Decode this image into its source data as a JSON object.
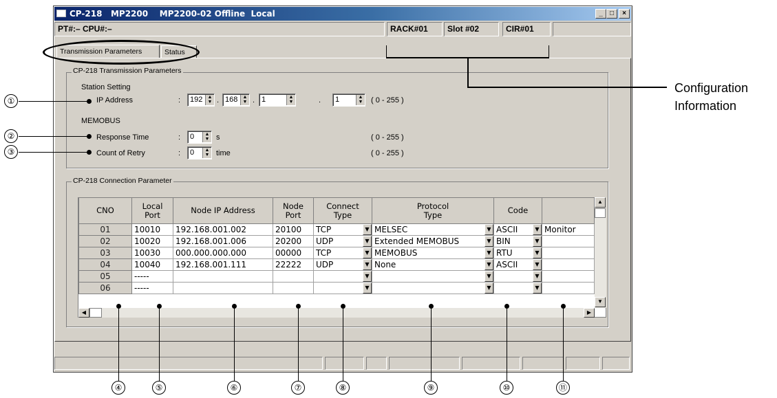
{
  "window": {
    "title": "CP-218   MP2200    MP2200-02 Offline  Local",
    "controls": [
      "_",
      "□",
      "×"
    ]
  },
  "info_bar": {
    "pt_cpu": "PT#:– CPU#:–",
    "rack": "RACK#01",
    "slot": "Slot #02",
    "cir": "CIR#01"
  },
  "tabs": [
    "Transmission Parameters",
    "Status"
  ],
  "transmission": {
    "group_title": "CP-218 Transmission Parameters",
    "station_setting": "Station Setting",
    "ip_label": "IP Address",
    "colon": ":",
    "ip": [
      "192",
      "168",
      "1",
      "1"
    ],
    "dot": ".",
    "ip_range": "( 0 - 255 )",
    "memobus": "MEMOBUS",
    "response_label": "Response Time",
    "response_value": "0",
    "response_unit": "s",
    "response_range": "( 0 - 255 )",
    "retry_label": "Count of Retry",
    "retry_value": "0",
    "retry_unit": "time",
    "retry_range": "( 0 - 255 )"
  },
  "connection": {
    "group_title": "CP-218 Connection Parameter",
    "headers": [
      "CNO",
      "Local\nPort",
      "Node IP Address",
      "Node\nPort",
      "Connect\nType",
      "Protocol\nType",
      "Code",
      ""
    ],
    "rows": [
      {
        "cno": "01",
        "local": "10010",
        "ip": "192.168.001.002",
        "node": "20100",
        "conn": "TCP",
        "proto": "MELSEC",
        "code": "ASCII",
        "extra": "Monitor"
      },
      {
        "cno": "02",
        "local": "10020",
        "ip": "192.168.001.006",
        "node": "20200",
        "conn": "UDP",
        "proto": "Extended MEMOBUS",
        "code": "BIN",
        "extra": ""
      },
      {
        "cno": "03",
        "local": "10030",
        "ip": "000.000.000.000",
        "node": "00000",
        "conn": "TCP",
        "proto": "MEMOBUS",
        "code": "RTU",
        "extra": ""
      },
      {
        "cno": "04",
        "local": "10040",
        "ip": "192.168.001.111",
        "node": "22222",
        "conn": "UDP",
        "proto": "None",
        "code": "ASCII",
        "extra": ""
      },
      {
        "cno": "05",
        "local": "-----",
        "ip": "",
        "node": "",
        "conn": "",
        "proto": "",
        "code": "",
        "extra": ""
      },
      {
        "cno": "06",
        "local": "-----",
        "ip": "",
        "node": "",
        "conn": "",
        "proto": "",
        "code": "",
        "extra": ""
      }
    ]
  },
  "annotations": {
    "config_info": "Configuration\nInformation",
    "markers": [
      "①",
      "②",
      "③",
      "④",
      "⑤",
      "⑥",
      "⑦",
      "⑧",
      "⑨",
      "⑩",
      "⑪"
    ]
  }
}
